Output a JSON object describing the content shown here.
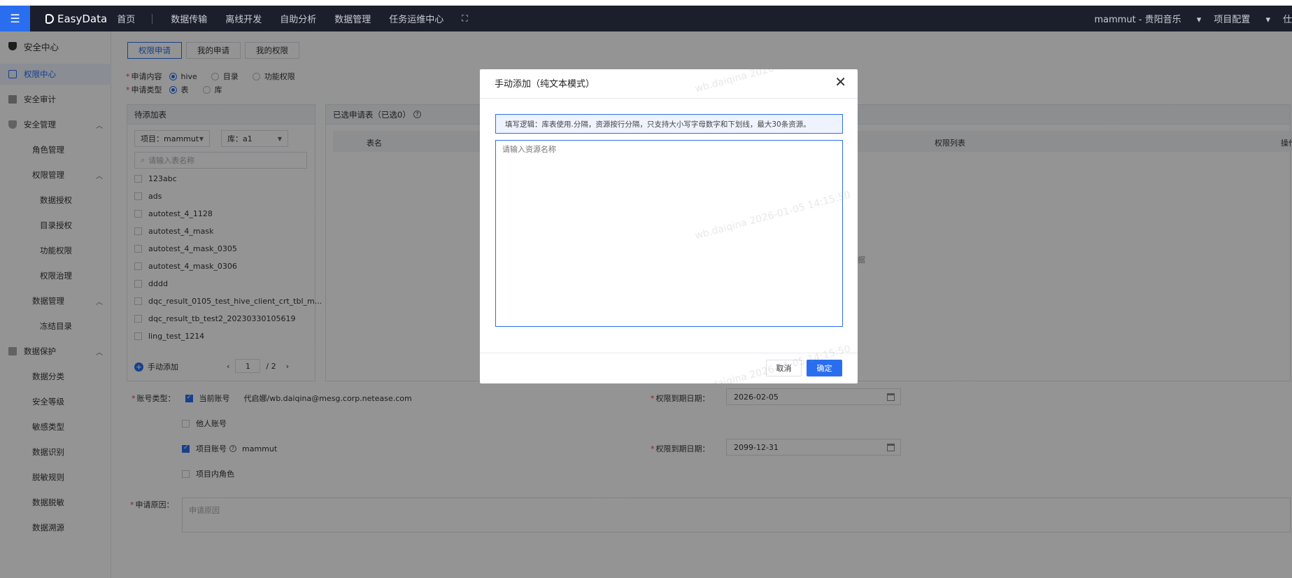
{
  "topbar": {
    "logo": "EasyData",
    "nav": [
      "首页",
      "数据传输",
      "离线开发",
      "自助分析",
      "数据管理",
      "任务运维中心"
    ],
    "user": "mammut - 贵阳音乐",
    "project_config": "项目配置",
    "trailing": "仕"
  },
  "sidebar": {
    "items": [
      {
        "label": "安全中心"
      },
      {
        "label": "权限中心"
      },
      {
        "label": "安全审计"
      },
      {
        "label": "安全管理"
      },
      {
        "label": "角色管理"
      },
      {
        "label": "权限管理"
      },
      {
        "label": "数据授权"
      },
      {
        "label": "目录授权"
      },
      {
        "label": "功能权限"
      },
      {
        "label": "权限治理"
      },
      {
        "label": "数据管理"
      },
      {
        "label": "冻结目录"
      },
      {
        "label": "数据保护"
      },
      {
        "label": "数据分类"
      },
      {
        "label": "安全等级"
      },
      {
        "label": "敏感类型"
      },
      {
        "label": "数据识别"
      },
      {
        "label": "脱敏规则"
      },
      {
        "label": "数据脱敏"
      },
      {
        "label": "数据溯源"
      }
    ]
  },
  "tabs": [
    "权限申请",
    "我的申请",
    "我的权限"
  ],
  "form": {
    "content_label": "申请内容",
    "content_options": [
      "hive",
      "目录",
      "功能权限"
    ],
    "type_label": "申请类型",
    "type_options": [
      "表",
      "库"
    ]
  },
  "left_panel": {
    "title": "待添加表",
    "project_select": "项目：mammut",
    "db_select": "库：a1",
    "search_placeholder": "请输入表名称",
    "items": [
      "123abc",
      "ads",
      "autotest_4_1128",
      "autotest_4_mask",
      "autotest_4_mask_0305",
      "autotest_4_mask_0306",
      "dddd",
      "dqc_result_0105_test_hive_client_crt_tbl_m...",
      "dqc_result_tb_test2_20230330105619",
      "ling_test_1214"
    ],
    "manual_add": "手动添加",
    "page_current": "1",
    "page_total": "/ 2"
  },
  "right_panel": {
    "title": "已选申请表（已选0）",
    "col_name": "表名",
    "col_perm": "权限列表",
    "col_op": "操作",
    "empty_hint": "据"
  },
  "account": {
    "label": "账号类型：",
    "current": "当前账号",
    "current_value": "代启娜/wb.daiqina@mesg.corp.netease.com",
    "other": "他人账号",
    "project": "项目账号",
    "project_value": "mammut",
    "project_role": "项目内角色",
    "expire_label": "权限到期日期：",
    "expire1": "2026-02-05",
    "expire2": "2099-12-31"
  },
  "reason": {
    "label": "申请原因：",
    "placeholder": "申请原因"
  },
  "modal": {
    "title": "手动添加（纯文本模式）",
    "hint": "填写逻辑：库表使用.分隔，资源按行分隔，只支持大小写字母数字和下划线，最大30条资源。",
    "textarea_placeholder": "请输入资源名称",
    "cancel": "取消",
    "ok": "确定"
  },
  "watermark": "wb.daiqina 2026-01-05 14:15:50"
}
